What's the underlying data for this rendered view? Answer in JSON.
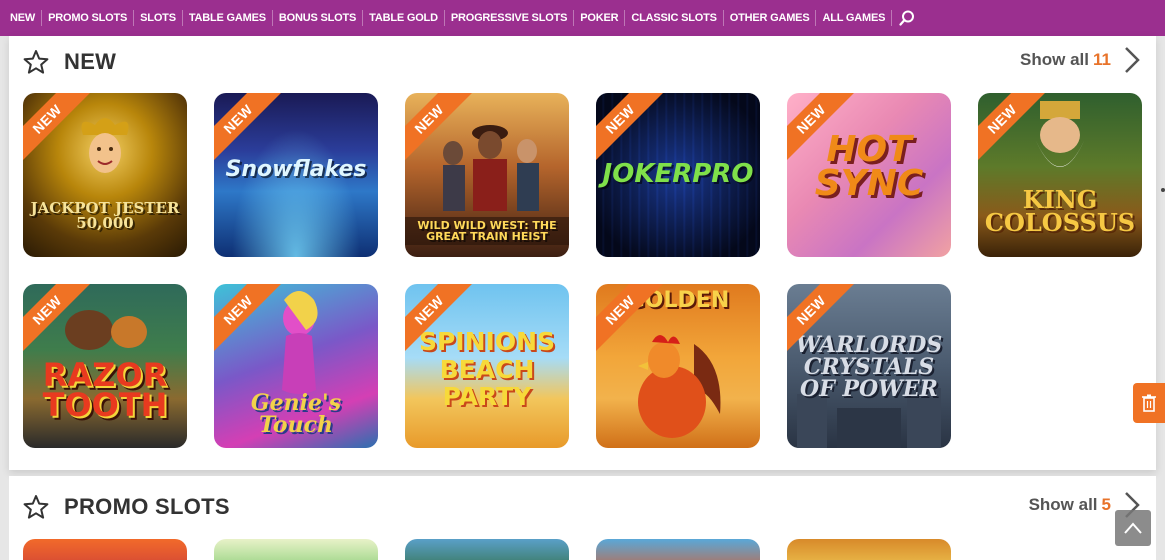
{
  "nav": {
    "items": [
      "NEW",
      "PROMO SLOTS",
      "SLOTS",
      "TABLE GAMES",
      "BONUS SLOTS",
      "TABLE GOLD",
      "PROGRESSIVE SLOTS",
      "POKER",
      "CLASSIC SLOTS",
      "OTHER GAMES",
      "ALL GAMES"
    ],
    "search_icon": "search-icon",
    "background": "#9b2f8f"
  },
  "sections": {
    "new": {
      "title": "NEW",
      "show_all": "Show all",
      "count": "11",
      "icon": "star-outline-icon"
    },
    "promo": {
      "title": "PROMO SLOTS",
      "show_all": "Show all",
      "count": "5",
      "icon": "star-outline-icon"
    }
  },
  "badge": "NEW",
  "games": [
    {
      "name": "JACKPOT JESTER 50,000",
      "badge": "NEW"
    },
    {
      "name": "Snowflakes",
      "badge": "NEW"
    },
    {
      "name": "WILD WILD WEST: THE GREAT TRAIN HEIST",
      "badge": "NEW"
    },
    {
      "name": "JOKERPRO",
      "badge": "NEW"
    },
    {
      "name": "HOT SYNC",
      "badge": "NEW"
    },
    {
      "name": "KING COLOSSUS",
      "badge": "NEW"
    },
    {
      "name": "RAZOR TOOTH",
      "badge": "NEW"
    },
    {
      "name": "Genie's Touch",
      "badge": "NEW"
    },
    {
      "name": "SPINIONS BEACH PARTY",
      "badge": "NEW"
    },
    {
      "name": "GOLDEN",
      "badge": "NEW"
    },
    {
      "name": "WARLORDS CRYSTALS OF POWER",
      "badge": "NEW"
    }
  ],
  "colors": {
    "accent": "#f07224",
    "brand": "#9b2f8f"
  }
}
